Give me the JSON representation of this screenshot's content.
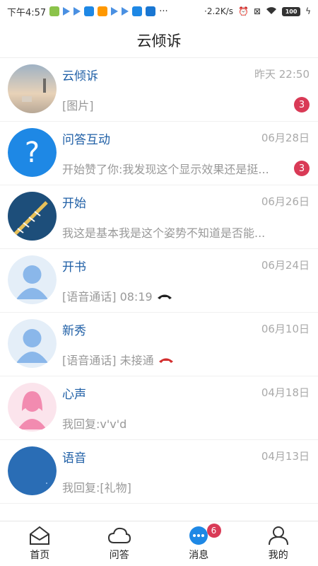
{
  "status_bar": {
    "time": "下午4:57",
    "net_speed": "·2.2K/s",
    "battery": "100"
  },
  "header": {
    "title": "云倾诉"
  },
  "conversations": [
    {
      "name": "云倾诉",
      "time": "昨天 22:50",
      "preview": "[图片]",
      "unread": "3"
    },
    {
      "name": "问答互动",
      "time": "06月28日",
      "preview": "开始赞了你:我发现这个显示效果还是挺...",
      "unread": "3"
    },
    {
      "name": "开始",
      "time": "06月26日",
      "preview": "我这是基本我是这个姿势不知道是否能...",
      "unread": ""
    },
    {
      "name": "开书",
      "time": "06月24日",
      "preview": "[语音通话] 08:19",
      "unread": ""
    },
    {
      "name": "新秀",
      "time": "06月10日",
      "preview": "[语音通话] 未接通",
      "unread": ""
    },
    {
      "name": "心声",
      "time": "04月18日",
      "preview": "我回复:v'v'd",
      "unread": ""
    },
    {
      "name": "语音",
      "time": "04月13日",
      "preview": "我回复:[礼物]",
      "unread": ""
    }
  ],
  "tabs": [
    {
      "label": "首页",
      "icon": "home-icon"
    },
    {
      "label": "问答",
      "icon": "cloud-icon"
    },
    {
      "label": "消息",
      "icon": "message-icon",
      "badge": "6"
    },
    {
      "label": "我的",
      "icon": "profile-icon"
    }
  ],
  "colors": {
    "name": "#1f5fa6",
    "badge": "#d93a56",
    "accent": "#1e88e5"
  }
}
